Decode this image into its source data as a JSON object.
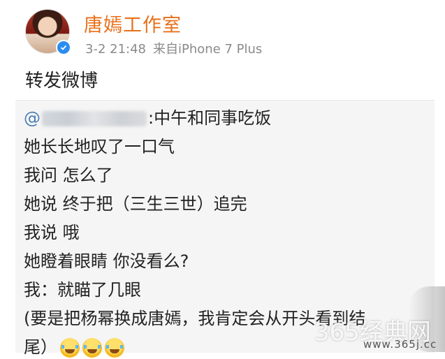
{
  "post": {
    "username": "唐嫣工作室",
    "date": "3-2 21:48",
    "source": "来自iPhone 7 Plus",
    "repost_label": "转发微博"
  },
  "quoted": {
    "mention_prefix": "@",
    "first_line_rest": ":中午和同事吃饭",
    "lines": [
      "她长长地叹了一口气",
      "我问 怎么了",
      "她说 终于把（三生三世）追完",
      "我说 哦",
      "她瞪着眼睛 你没看么?",
      "我：就瞄了几眼",
      "(要是把杨幂换成唐嫣，我肯定会从开头看到结",
      "尾）"
    ]
  },
  "watermark": {
    "brand": "365经典网",
    "url": "www.365j.cc"
  },
  "colors": {
    "username": "#e8701a",
    "meta": "#8a8a8a",
    "quoted_bg": "#f5f5f5",
    "verified": "#2d8cf0"
  },
  "icons": [
    "verified-badge-icon",
    "laugh-cry-emoji-icon"
  ]
}
